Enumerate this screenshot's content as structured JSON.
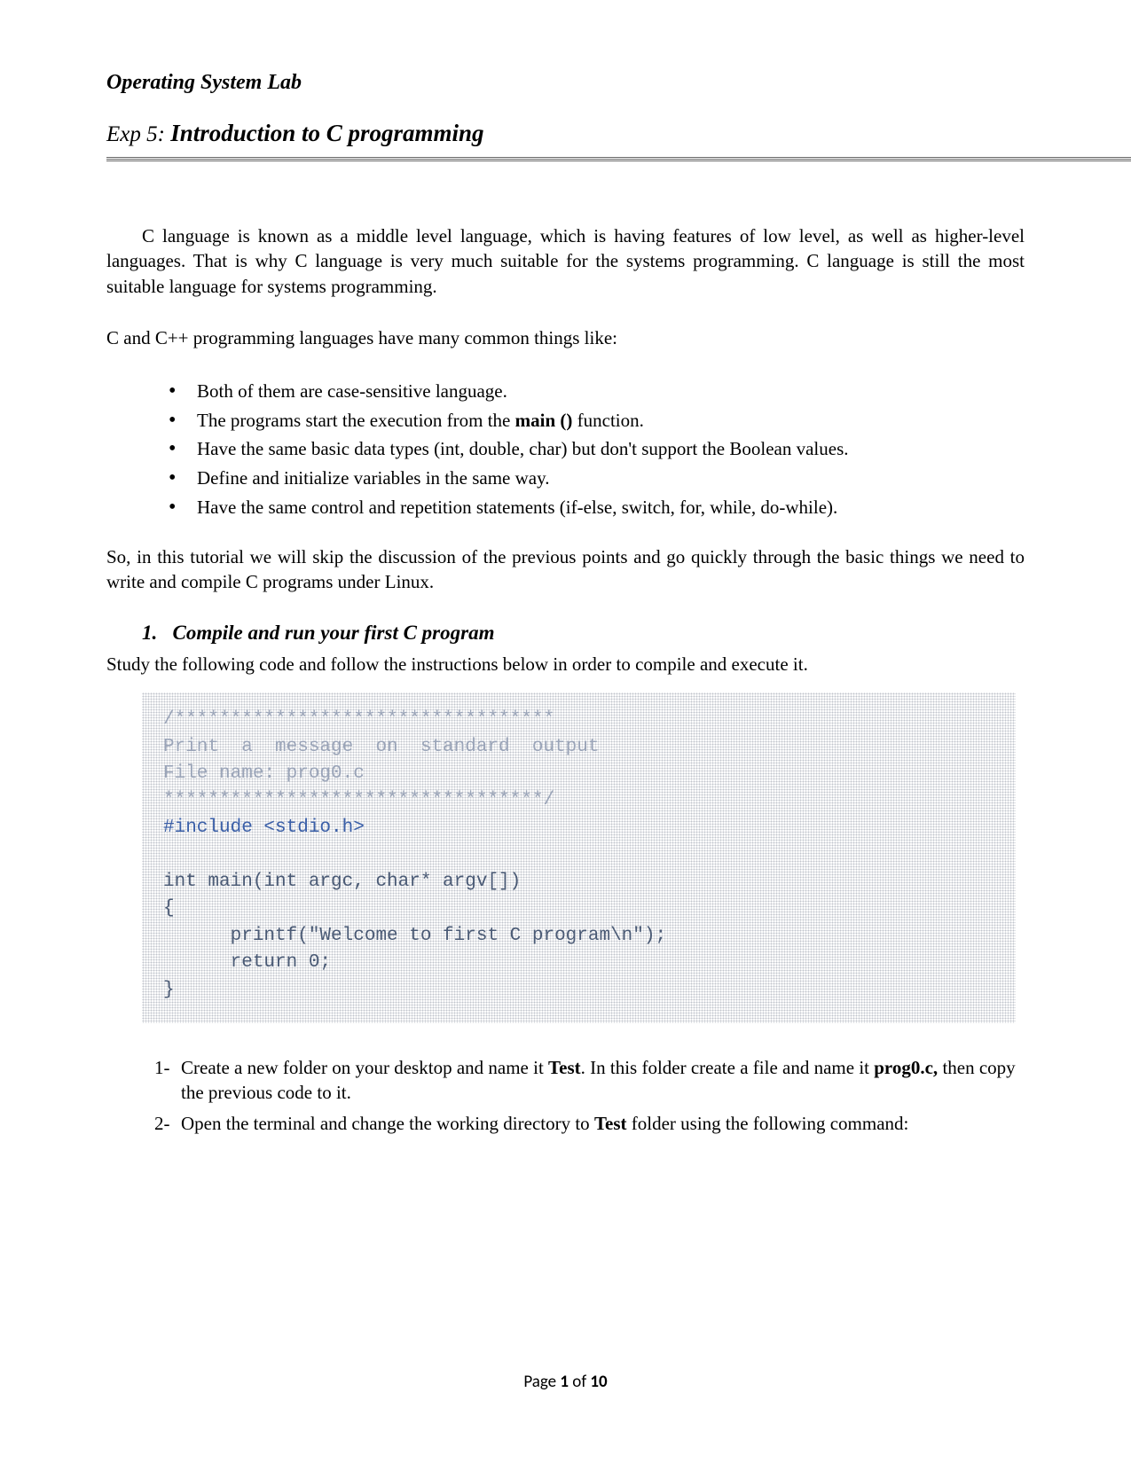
{
  "header": {
    "lab_title": "Operating System Lab",
    "exp_label": "Exp 5: ",
    "exp_title": "Introduction  to C programming"
  },
  "paragraphs": {
    "intro": "C language is known as a middle level language, which is having features of low level, as well as higher-level languages. That is why C language is very much suitable for the systems programming. C language is still the most suitable  language for systems programming.",
    "common_lead": "C and C++ programming  languages have many common things like:",
    "after_bullets": "So, in this tutorial we will skip the discussion of the previous points and go quickly  through the basic things we need to write and compile  C programs under Linux.",
    "after_heading": "Study the following  code and follow the instructions  below in order to compile and execute it."
  },
  "bullets": [
    "Both of them are case-sensitive language.",
    "The programs  start the execution from the ",
    "Have the same basic data types (int, double,  char) but don't support the Boolean values.",
    "Define and initialize  variables in the same way.",
    "Have the same control and repetition statements (if-else, switch, for, while, do-while)."
  ],
  "bullet_main_bold": "main ()",
  "bullet_main_tail": " function.",
  "section": {
    "number": "1.",
    "title": "Compile and run your first C program"
  },
  "code": {
    "c1": "/**********************************",
    "c2": "Print  a  message  on  standard  output",
    "c3": "File name: prog0.c",
    "c4": "**********************************/",
    "inc": "#include <stdio.h>",
    "l1": "int main(int argc, char* argv[])",
    "l2": "{",
    "l3": "      printf(\"Welcome to first C program\\n\");",
    "l4": "      return 0;",
    "l5": "}"
  },
  "steps": {
    "s1_a": "Create a new folder on your desktop and name it ",
    "s1_b": "Test",
    "s1_c": ". In this folder create a file and name it ",
    "s1_d": "prog0.c,",
    "s1_e": " then copy the previous code to it.",
    "s2_a": "Open the terminal and change the working  directory to ",
    "s2_b": "Test",
    "s2_c": " folder using the following command:"
  },
  "footer": {
    "prefix": "Page ",
    "current": "1",
    "middle": " of ",
    "total": "10"
  }
}
